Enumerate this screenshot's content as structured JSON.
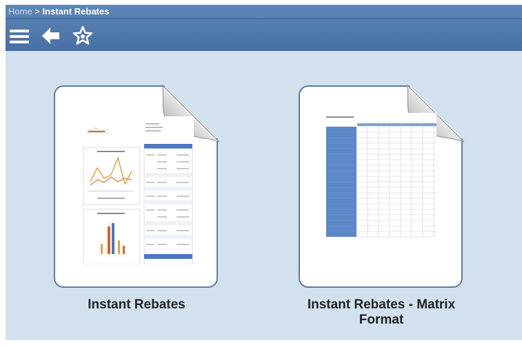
{
  "breadcrumb": {
    "home": "Home",
    "separator": ">",
    "current": "Instant Rebates"
  },
  "toolbar": {
    "menu_icon": "hamburger-menu-icon",
    "back_icon": "back-arrow-icon",
    "favorite_icon": "star-icon"
  },
  "items": [
    {
      "label": "Instant Rebates",
      "icon": "report-document-icon"
    },
    {
      "label": "Instant Rebates - Matrix Format",
      "icon": "report-document-icon"
    }
  ],
  "colors": {
    "header": "#4f77aa",
    "content_bg": "#d3e0ee",
    "tile_border": "#5a7aa0",
    "label_text": "#222222"
  }
}
